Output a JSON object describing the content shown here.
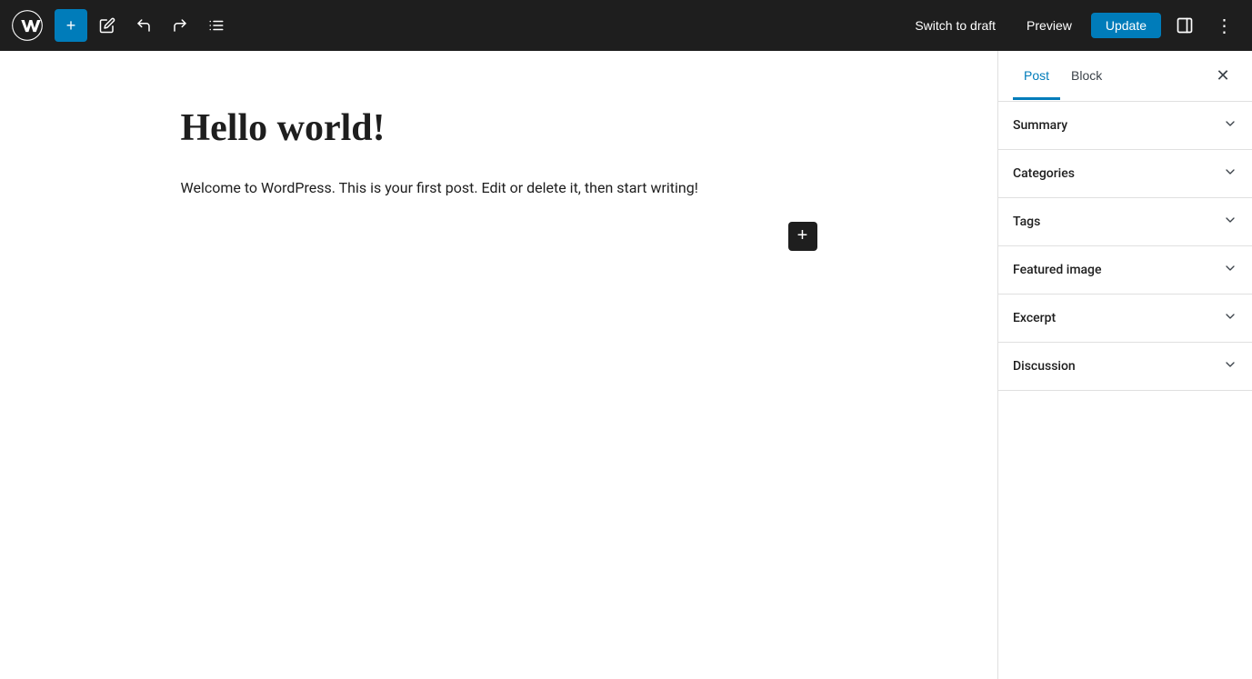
{
  "toolbar": {
    "add_label": "+",
    "edit_label": "✏",
    "undo_label": "↩",
    "redo_label": "↪",
    "list_view_label": "☰",
    "switch_draft_label": "Switch to draft",
    "preview_label": "Preview",
    "update_label": "Update",
    "more_options_label": "⋮"
  },
  "editor": {
    "post_title": "Hello world!",
    "post_body": "Welcome to WordPress. This is your first post. Edit or delete it, then start writing!",
    "add_block_label": "+"
  },
  "sidebar": {
    "post_tab_label": "Post",
    "block_tab_label": "Block",
    "close_label": "✕",
    "panels": [
      {
        "id": "summary",
        "title": "Summary"
      },
      {
        "id": "categories",
        "title": "Categories"
      },
      {
        "id": "tags",
        "title": "Tags"
      },
      {
        "id": "featured-image",
        "title": "Featured image"
      },
      {
        "id": "excerpt",
        "title": "Excerpt"
      },
      {
        "id": "discussion",
        "title": "Discussion"
      }
    ]
  }
}
